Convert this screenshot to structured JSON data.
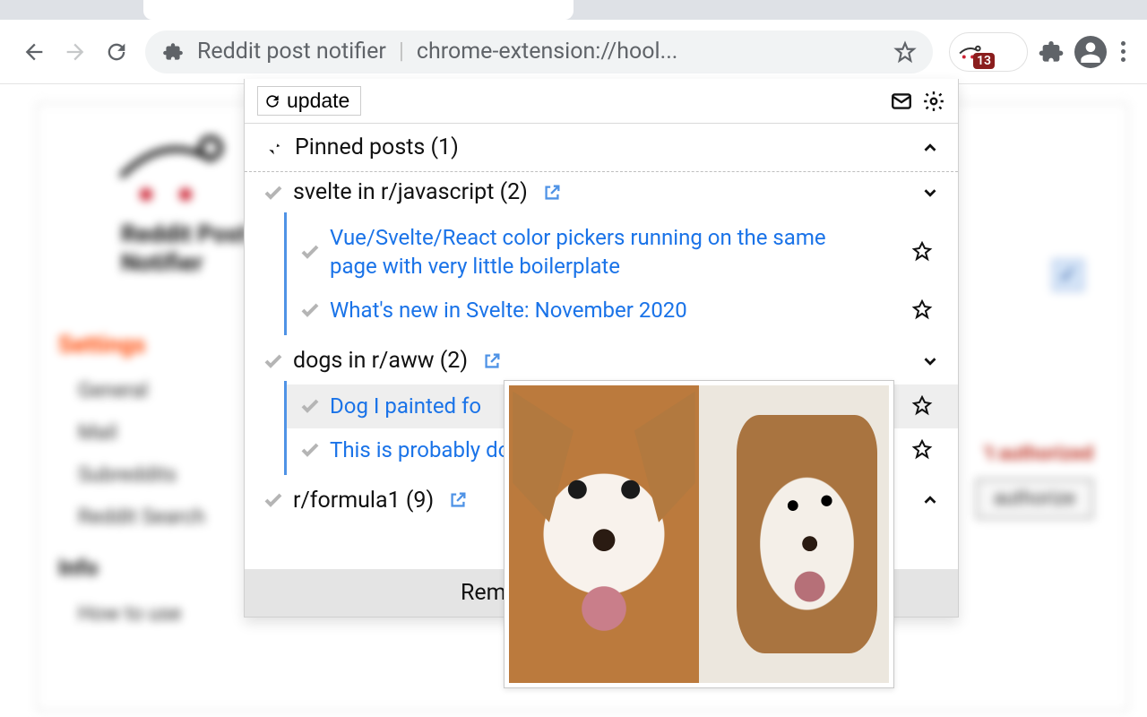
{
  "omnibox": {
    "app_label": "Reddit post notifier",
    "url_fragment": "chrome-extension://hool..."
  },
  "extension_badge": "13",
  "popup": {
    "update_label": "update",
    "pinned_header": "Pinned posts (1)",
    "footer": "Remove all not pinned posts",
    "groups": [
      {
        "title": "svelte in r/javascript (2)",
        "expanded": true,
        "posts": [
          {
            "title": "Vue/Svelte/React color pickers running on the same page with very little boilerplate",
            "hovered": false
          },
          {
            "title": "What's new in Svelte: November 2020",
            "hovered": false
          }
        ]
      },
      {
        "title": "dogs in r/aww (2)",
        "expanded": true,
        "posts": [
          {
            "title": "Dog I painted fo",
            "hovered": true
          },
          {
            "title": "This is probably dog, Thor",
            "hovered": false
          }
        ]
      },
      {
        "title": "r/formula1 (9)",
        "expanded": false,
        "posts": []
      }
    ]
  },
  "background": {
    "title_line1": "Reddit Post",
    "title_line2": "Notifier",
    "settings_header": "Settings",
    "settings_items": [
      "General",
      "Mail",
      "Subreddits",
      "Reddit Search"
    ],
    "info_header": "Info",
    "info_items": [
      "How to use"
    ],
    "right_warning": "'t authorized",
    "authorize_button": "authorize"
  }
}
